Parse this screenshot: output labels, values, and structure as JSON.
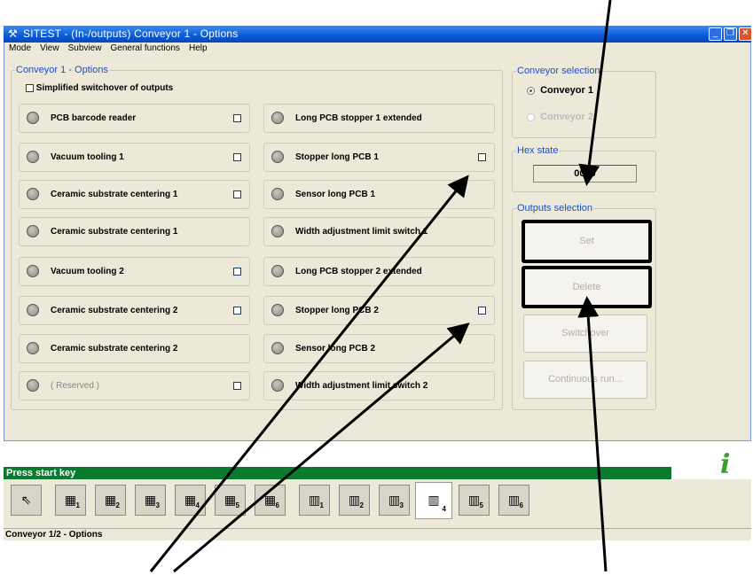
{
  "window": {
    "title": "SITEST - (In-/outputs) Conveyor 1 - Options",
    "app_icon": "tool-icon",
    "buttons": {
      "minimize": "_",
      "maximize": "❐",
      "close": "✕"
    }
  },
  "menu": [
    "Mode",
    "View",
    "Subview",
    "General functions",
    "Help"
  ],
  "options_group": {
    "legend": "Conveyor 1 - Options",
    "simplified_label": "Simplified switchover of outputs",
    "left_items": [
      {
        "label": "PCB barcode reader"
      },
      {
        "label": "Vacuum tooling 1"
      },
      {
        "label": "Ceramic substrate centering 1"
      },
      {
        "label": "Ceramic substrate centering 1"
      },
      {
        "label": "Vacuum tooling 2"
      },
      {
        "label": "Ceramic substrate centering 2"
      },
      {
        "label": "Ceramic substrate centering 2"
      },
      {
        "label": "( Reserved )"
      }
    ],
    "right_items": [
      {
        "label": "Long PCB stopper 1 extended"
      },
      {
        "label": "Stopper long PCB 1"
      },
      {
        "label": "Sensor long PCB 1"
      },
      {
        "label": "Width adjustment limit switch 1"
      },
      {
        "label": "Long PCB stopper 2 extended"
      },
      {
        "label": "Stopper long PCB 2"
      },
      {
        "label": "Sensor long PCB 2"
      },
      {
        "label": "Width adjustment limit switch 2"
      }
    ]
  },
  "conveyor_selection": {
    "legend": "Conveyor selection",
    "option1": "Conveyor 1",
    "option2": "Conveyor 2",
    "selected": "Conveyor 1"
  },
  "hex_state": {
    "legend": "Hex state",
    "value": "0000"
  },
  "outputs_selection": {
    "legend": "Outputs selection",
    "set": "Set",
    "delete": "Delete",
    "switchover": "Switchover",
    "continuous": "Continuous run..."
  },
  "status": {
    "message": "Press start key",
    "footer": "Conveyor 1/2 - Options"
  },
  "toolbar": {
    "items": [
      {
        "icon": "cursor-arrow-icon",
        "num": ""
      },
      {
        "icon": "io-module-icon",
        "num": "1"
      },
      {
        "icon": "io-module-icon",
        "num": "2"
      },
      {
        "icon": "io-module-icon",
        "num": "3"
      },
      {
        "icon": "io-module-icon",
        "num": "4"
      },
      {
        "icon": "io-module-icon",
        "num": "5"
      },
      {
        "icon": "io-module-icon",
        "num": "6"
      },
      {
        "icon": "io-module-alt-icon",
        "num": "1"
      },
      {
        "icon": "io-module-alt-icon",
        "num": "2"
      },
      {
        "icon": "io-module-alt-icon",
        "num": "3"
      },
      {
        "icon": "io-module-alt-icon",
        "num": "4"
      },
      {
        "icon": "io-module-alt-icon",
        "num": "5"
      },
      {
        "icon": "io-module-alt-icon",
        "num": "6"
      }
    ],
    "active_index": 10
  }
}
